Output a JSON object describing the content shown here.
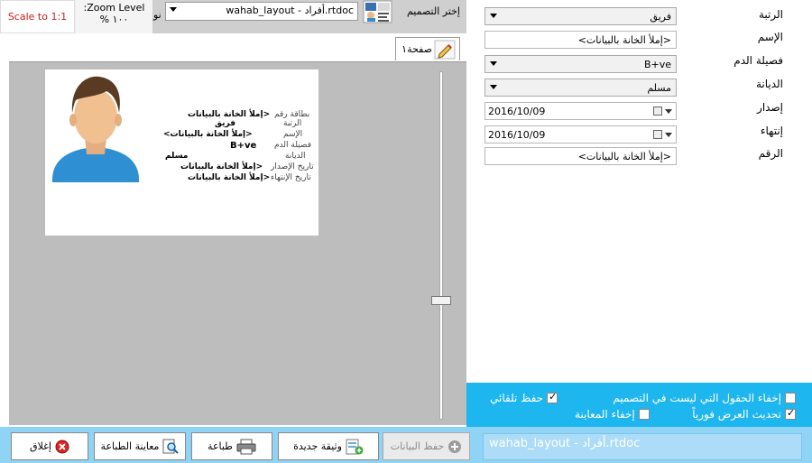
{
  "topbar": {
    "scale_label": "Scale to 1:1",
    "zoom_line1": ":Zoom Level",
    "zoom_line2": "% ١٠٠",
    "nu_text": "نو",
    "design_value": "wahab_layout - أفراد.rtdoc",
    "choose_design_label": "إختر التصميم"
  },
  "preview": {
    "page_tab_label": "صفحة١",
    "card": {
      "rows": [
        {
          "label": "بطاقة رقم",
          "value": "إملأ الخانة بالبيانات>"
        },
        {
          "label": "الرتبة",
          "value": "فريق"
        },
        {
          "label": "الإسم",
          "value": "<إملأ الخانة بالبيانات>"
        },
        {
          "label": "فصيلة الدم",
          "value": "B+ve"
        },
        {
          "label": "الديانة",
          "value": "مسلم"
        },
        {
          "label": "تاريخ الإصدار",
          "value": "إملأ الخانة بالبيانات>"
        },
        {
          "label": "تاريخ الإنتهاء",
          "value": "إملأ الخانة بالبيانات>"
        }
      ]
    }
  },
  "form": {
    "rank": {
      "label": "الرتبة",
      "value": "فريق"
    },
    "name": {
      "label": "الإسم",
      "value": "<إملأ الخانة بالبيانات>"
    },
    "blood": {
      "label": "فصيلة الدم",
      "value": "B+ve"
    },
    "religion": {
      "label": "الديانة",
      "value": "مسلم"
    },
    "issue": {
      "label": "إصدار",
      "value": "2016/10/09"
    },
    "expiry": {
      "label": "إنتهاء",
      "value": "2016/10/09"
    },
    "number": {
      "label": "الرقم",
      "value": "<إملأ الخانة بالبيانات>"
    }
  },
  "options": {
    "hide_fields": "إخفاء الحقول التي ليست في التصميم",
    "auto_save": "حفظ تلقائي",
    "live_update": "تحديث العرض فورياً",
    "hide_preview": "إخفاء المعاينة"
  },
  "bottom": {
    "close": "إغلاق",
    "print_preview": "معاينة الطباعة",
    "print": "طباعة",
    "new_doc": "وثيقة جديدة",
    "save_data": "حفظ البيانات",
    "status": "wahab_layout - أفراد.rtdoc"
  }
}
